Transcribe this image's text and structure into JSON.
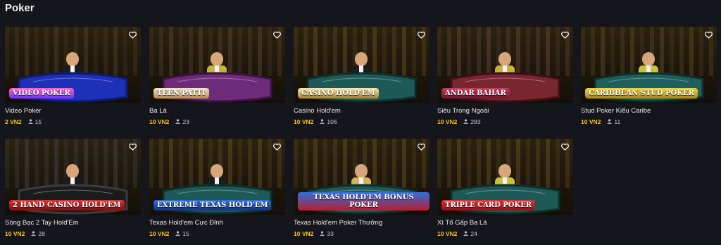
{
  "section": {
    "title": "Poker"
  },
  "colors": {
    "background": "#14161c",
    "bet": "#f5c518",
    "players": "#c7c7c7"
  },
  "cards": [
    {
      "name": "Video Poker",
      "bet": "2 VN2",
      "players": "15",
      "logo": "VIDEO POKER",
      "logo_style": "video"
    },
    {
      "name": "Ba Lá",
      "bet": "10 VN2",
      "players": "23",
      "logo": "TEEN PATTI",
      "logo_style": "teen"
    },
    {
      "name": "Casino Hold'em",
      "bet": "10 VN2",
      "players": "106",
      "logo": "CASINO HOLD'EM",
      "logo_style": "casino"
    },
    {
      "name": "Siêu Trong Ngoài",
      "bet": "10 VN2",
      "players": "283",
      "logo": "ANDAR BAHAR",
      "logo_style": "andar"
    },
    {
      "name": "Stud Poker Kiểu Caribe",
      "bet": "10 VN2",
      "players": "11",
      "logo": "CARIBBEAN STUD POKER",
      "logo_style": "caribbean"
    },
    {
      "name": "Sòng Bạc 2 Tay Hold'Em",
      "bet": "10 VN2",
      "players": "28",
      "logo": "2 HAND CASINO HOLD'EM",
      "logo_style": "twohand"
    },
    {
      "name": "Texas Hold'em Cực Đỉnh",
      "bet": "10 VN2",
      "players": "15",
      "logo": "EXTREME TEXAS HOLD'EM",
      "logo_style": "extreme"
    },
    {
      "name": "Texas Hold'em Poker Thưởng",
      "bet": "10 VN2",
      "players": "33",
      "logo": "TEXAS HOLD'EM BONUS POKER",
      "logo_style": "texas"
    },
    {
      "name": "Xì Tố Gấp Ba Lá",
      "bet": "10 VN2",
      "players": "24",
      "logo": "TRIPLE CARD POKER",
      "logo_style": "triple"
    }
  ]
}
